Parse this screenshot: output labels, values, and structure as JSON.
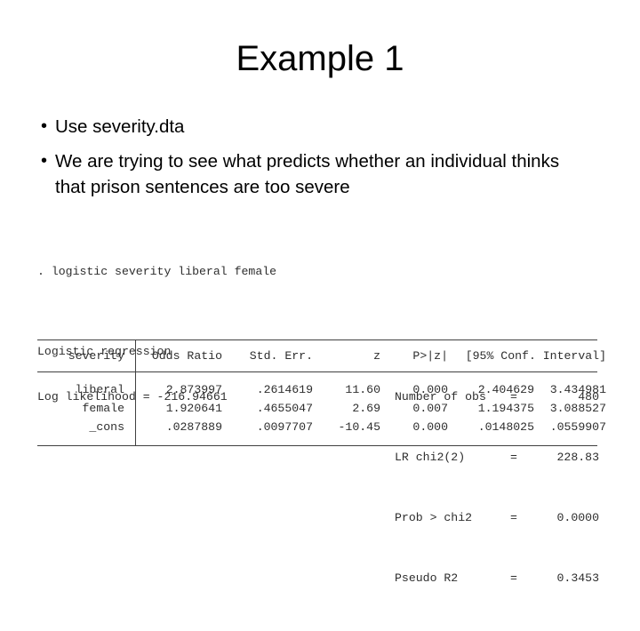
{
  "slide": {
    "title": "Example 1",
    "bullet_marker": "•",
    "bullets": [
      "Use severity.dta",
      "We are trying to see what predicts whether an individual thinks that prison sentences are too severe"
    ]
  },
  "stata_output": {
    "command_line": ". logistic severity liberal female",
    "model_title": "Logistic regression",
    "log_likelihood_line": "Log likelihood = -216.94661",
    "equals_sign": "=",
    "stats": [
      {
        "label": "Number of obs",
        "value": "480"
      },
      {
        "label": "LR chi2(2)",
        "value": "228.83"
      },
      {
        "label": "Prob > chi2",
        "value": "0.0000"
      },
      {
        "label": "Pseudo R2",
        "value": "0.3453"
      }
    ],
    "table": {
      "headers": {
        "depvar": "severity",
        "odds_ratio": "Odds Ratio",
        "std_err": "Std. Err.",
        "z": "z",
        "p": "P>|z|",
        "conf_interval": "[95% Conf. Interval]"
      },
      "rows": [
        {
          "term": "liberal",
          "odds_ratio": "2.873997",
          "std_err": ".2614619",
          "z": "11.60",
          "p": "0.000",
          "ci_low": "2.404629",
          "ci_high": "3.434981"
        },
        {
          "term": "female",
          "odds_ratio": "1.920641",
          "std_err": ".4655047",
          "z": "2.69",
          "p": "0.007",
          "ci_low": "1.194375",
          "ci_high": "3.088527"
        },
        {
          "term": "_cons",
          "odds_ratio": ".0287889",
          "std_err": ".0097707",
          "z": "-10.45",
          "p": "0.000",
          "ci_low": ".0148025",
          "ci_high": ".0559907"
        }
      ]
    }
  }
}
